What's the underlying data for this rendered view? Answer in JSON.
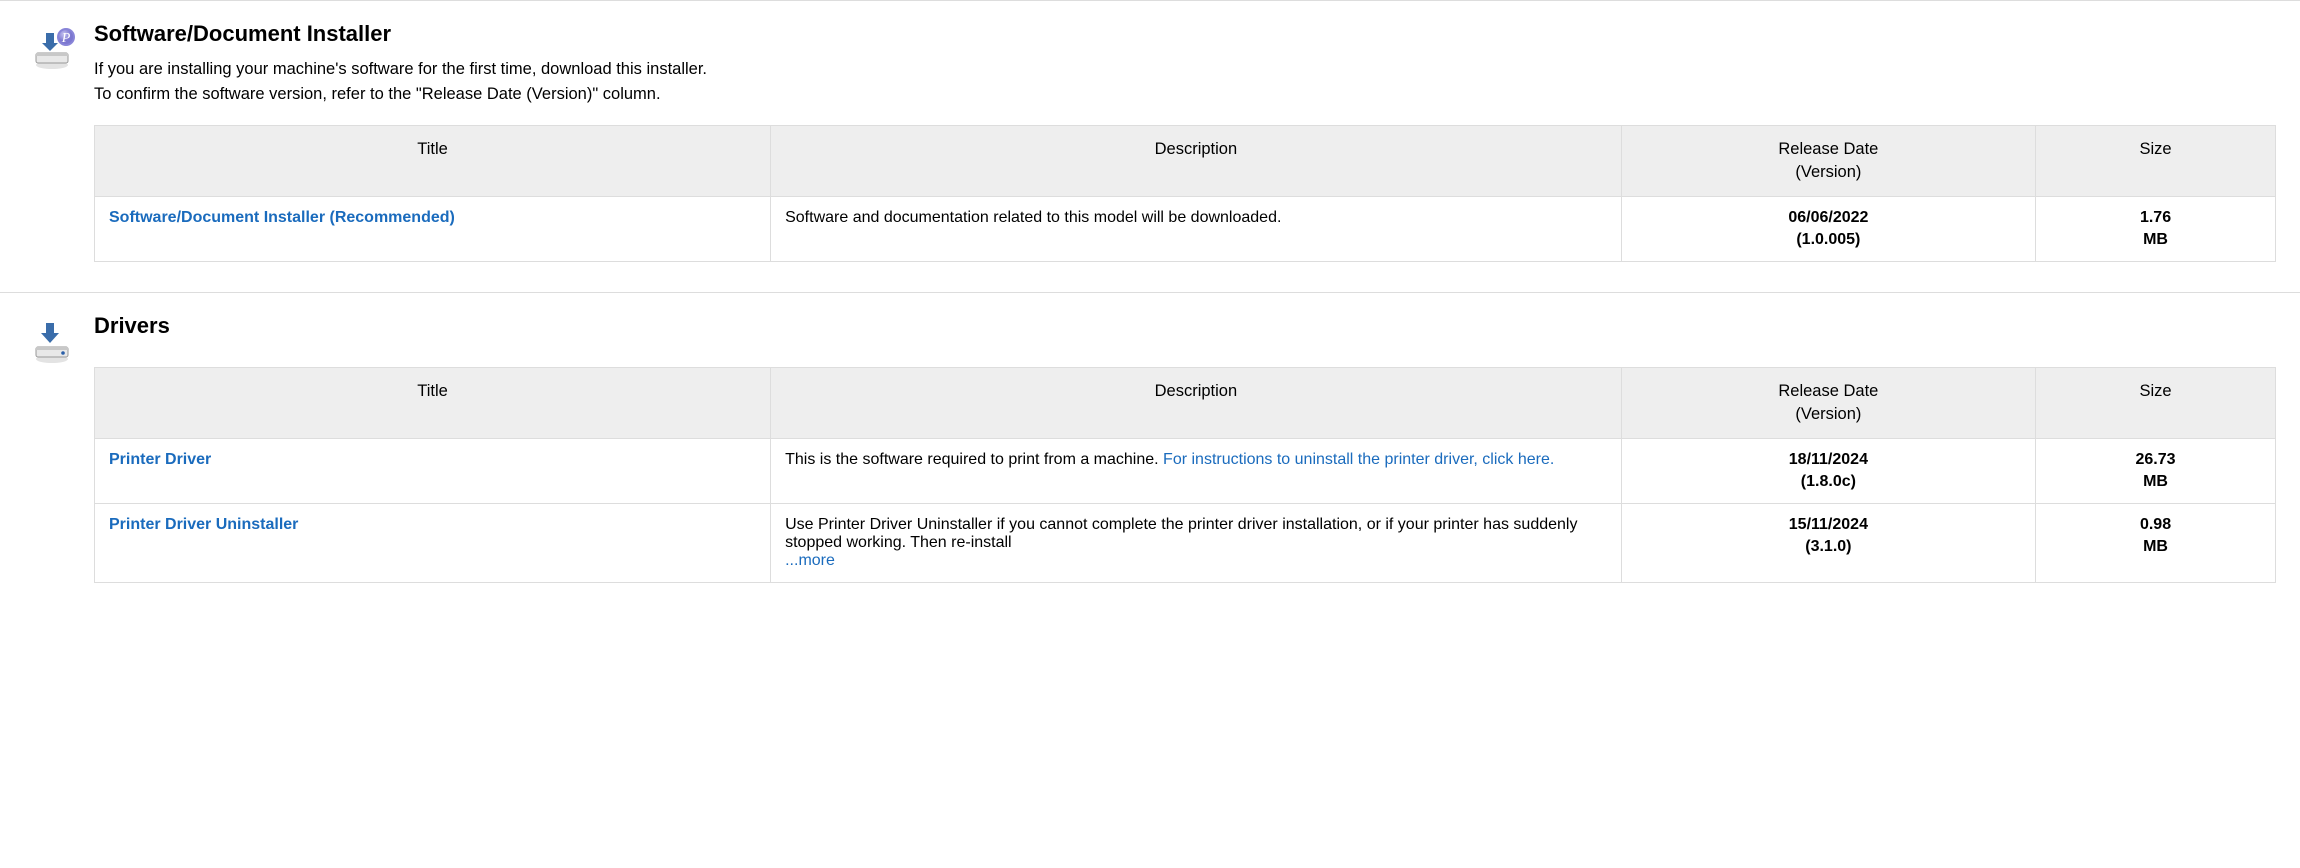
{
  "columns": {
    "title": "Title",
    "description": "Description",
    "release": "Release Date",
    "release_sub": "(Version)",
    "size": "Size"
  },
  "section1": {
    "heading": "Software/Document Installer",
    "intro_line1": "If you are installing your machine's software for the first time, download this installer.",
    "intro_line2": "To confirm the software version, refer to the \"Release Date (Version)\" column.",
    "row": {
      "title": "Software/Document Installer (Recommended)",
      "description": "Software and documentation related to this model will be downloaded.",
      "date": "06/06/2022",
      "version": "(1.0.005)",
      "size": "1.76",
      "size_unit": "MB"
    }
  },
  "section2": {
    "heading": "Drivers",
    "rows": [
      {
        "title": "Printer Driver",
        "desc_text": "This is the software required to print from a machine. ",
        "desc_link": "For instructions to uninstall the printer driver, click here.",
        "date": "18/11/2024",
        "version": "(1.8.0c)",
        "size": "26.73",
        "size_unit": "MB"
      },
      {
        "title": "Printer Driver Uninstaller",
        "desc_text": "Use Printer Driver Uninstaller if you cannot complete the printer driver installation, or if your printer has suddenly stopped working. Then re-install ",
        "more": "...more",
        "date": "15/11/2024",
        "version": "(3.1.0)",
        "size": "0.98",
        "size_unit": "MB"
      }
    ]
  }
}
